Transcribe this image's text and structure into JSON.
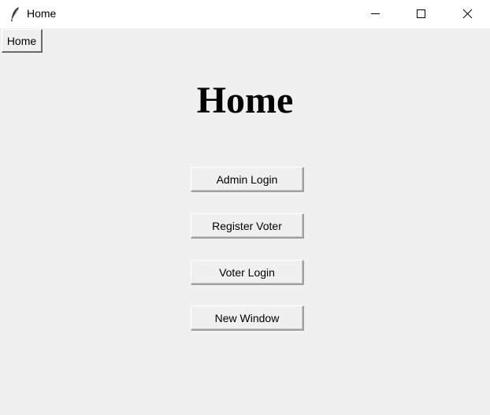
{
  "window": {
    "title": "Home",
    "app_icon": "feather-icon",
    "controls": {
      "minimize_icon": "minimize-icon",
      "maximize_icon": "maximize-icon",
      "close_icon": "close-icon"
    }
  },
  "menu": {
    "home_label": "Home"
  },
  "main": {
    "heading": "Home",
    "buttons": {
      "admin_login": "Admin Login",
      "register_voter": "Register Voter",
      "voter_login": "Voter Login",
      "new_window": "New Window"
    }
  },
  "colors": {
    "background": "#f0f0f0",
    "titlebar": "#ffffff"
  }
}
